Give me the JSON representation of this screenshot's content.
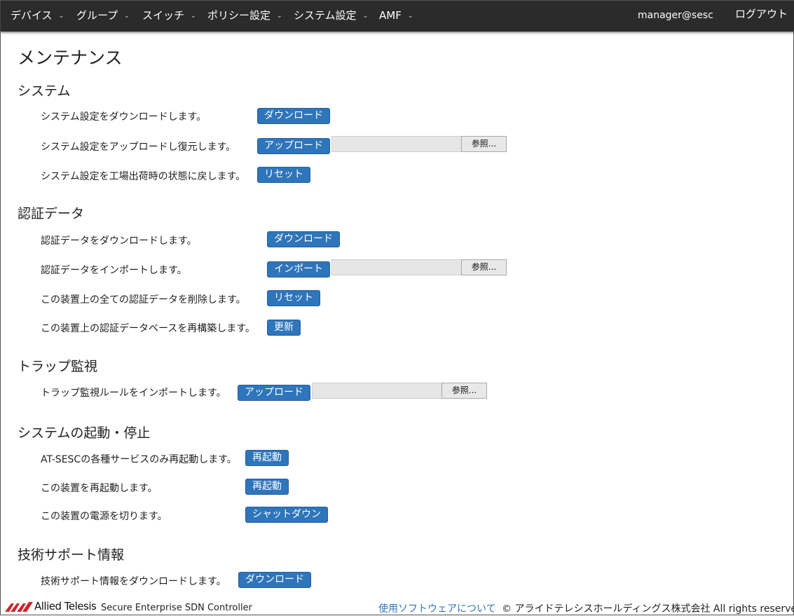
{
  "nav": {
    "items": [
      "デバイス",
      "グループ",
      "スイッチ",
      "ポリシー設定",
      "システム設定",
      "AMF"
    ],
    "user": "manager@sesc",
    "logout": "ログアウト"
  },
  "page": {
    "title": "メンテナンス"
  },
  "sections": [
    {
      "title": "システム",
      "rows": [
        {
          "label": "システム設定をダウンロードします。",
          "button": "ダウンロード"
        },
        {
          "label": "システム設定をアップロードし復元します。",
          "button": "アップロード",
          "file_button": "参照..."
        },
        {
          "label": "システム設定を工場出荷時の状態に戻します。",
          "button": "リセット"
        }
      ]
    },
    {
      "title": "認証データ",
      "rows": [
        {
          "label": "認証データをダウンロードします。",
          "button": "ダウンロード"
        },
        {
          "label": "認証データをインポートします。",
          "button": "インポート",
          "file_button": "参照..."
        },
        {
          "label": "この装置上の全ての認証データを削除します。",
          "button": "リセット"
        },
        {
          "label": "この装置上の認証データベースを再構築します。",
          "button": "更新"
        }
      ]
    },
    {
      "title": "トラップ監視",
      "rows": [
        {
          "label": "トラップ監視ルールをインポートします。",
          "button": "アップロード",
          "file_button": "参照..."
        }
      ]
    },
    {
      "title": "システムの起動・停止",
      "rows": [
        {
          "label": "AT-SESCの各種サービスのみ再起動します。",
          "button": "再起動"
        },
        {
          "label": "この装置を再起動します。",
          "button": "再起動"
        },
        {
          "label": "この装置の電源を切ります。",
          "button": "シャットダウン"
        }
      ]
    },
    {
      "title": "技術サポート情報",
      "rows": [
        {
          "label": "技術サポート情報をダウンロードします。",
          "button": "ダウンロード"
        }
      ]
    }
  ],
  "footer": {
    "logo_text": "Allied Telesis",
    "product": "Secure Enterprise SDN Controller",
    "link": "使用ソフトウェアについて",
    "copyright": "© アライドテレシスホールディングス株式会社 All rights reserved."
  },
  "colors": {
    "nav_bg": "#2b2b2b",
    "button_primary": "#2e75bb",
    "link": "#2e75bb",
    "logo_red": "#d2232a"
  }
}
